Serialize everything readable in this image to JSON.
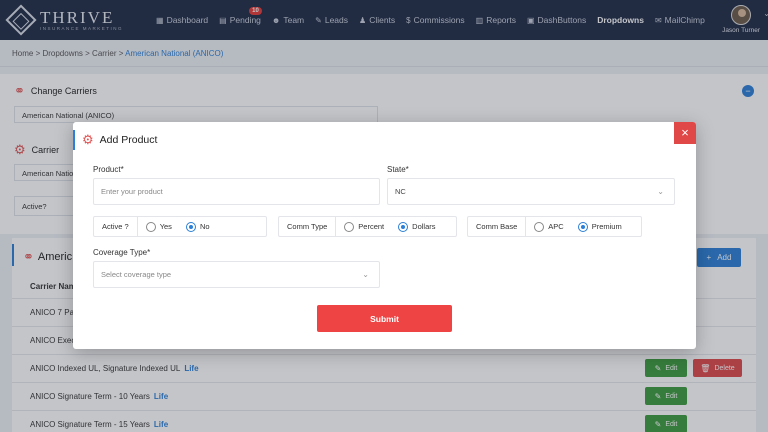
{
  "nav": {
    "logo_title": "THRIVE",
    "logo_subtitle": "INSURANCE MARKETING",
    "items": [
      {
        "label": "Dashboard",
        "icon": "grid-icon"
      },
      {
        "label": "Pending",
        "icon": "clipboard-icon",
        "badge": "10"
      },
      {
        "label": "Team",
        "icon": "team-icon"
      },
      {
        "label": "Leads",
        "icon": "leads-icon"
      },
      {
        "label": "Clients",
        "icon": "user-icon"
      },
      {
        "label": "Commissions",
        "icon": "dollar-icon"
      },
      {
        "label": "Reports",
        "icon": "chart-icon"
      },
      {
        "label": "DashButtons",
        "icon": "buttons-icon"
      },
      {
        "label": "Dropdowns",
        "icon": "none",
        "active": true
      },
      {
        "label": "MailChimp",
        "icon": "mail-icon"
      }
    ],
    "user_name": "Jason Turner"
  },
  "breadcrumb": {
    "path": "Home > Dropdowns > Carrier > ",
    "current": "American National (ANICO)"
  },
  "background": {
    "change_carriers_title": "Change Carriers",
    "carrier_select_value": "American National (ANICO)",
    "carrier_title": "Carrier",
    "carrier_value": "American Natio",
    "active_label": "Active?",
    "table_title": "Americ",
    "carrier_name_header": "Carrier Nam",
    "add_label": "Add",
    "rows": [
      {
        "name": "ANICO 7 Pa",
        "tag": "",
        "edit": "",
        "delete": ""
      },
      {
        "name": "ANICO Exec",
        "tag": "",
        "edit": "",
        "delete": ""
      },
      {
        "name": "ANICO Indexed UL, Signature Indexed UL",
        "tag": "Life",
        "edit": "Edit",
        "delete": "Delete"
      },
      {
        "name": "ANICO Signature Term - 10 Years",
        "tag": "Life",
        "edit": "Edit",
        "delete": ""
      },
      {
        "name": "ANICO Signature Term - 15 Years",
        "tag": "Life",
        "edit": "Edit",
        "delete": ""
      }
    ]
  },
  "modal": {
    "title": "Add Product",
    "close": "×",
    "product_label": "Product*",
    "product_placeholder": "Enter your product",
    "state_label": "State*",
    "state_value": "NC",
    "active": {
      "label": "Active ?",
      "yes": "Yes",
      "no": "No",
      "selected": "No"
    },
    "comm_type": {
      "label": "Comm Type",
      "opt1": "Percent",
      "opt2": "Dollars",
      "selected": "Dollars"
    },
    "comm_base": {
      "label": "Comm Base",
      "opt1": "APC",
      "opt2": "Premium",
      "selected": "Premium"
    },
    "coverage_label": "Coverage Type*",
    "coverage_placeholder": "Select coverage type",
    "submit": "Submit"
  },
  "colors": {
    "nav_bg": "#1f2a44",
    "accent": "#2b7fd6",
    "danger": "#ef4444",
    "success": "#3c9a3c"
  }
}
